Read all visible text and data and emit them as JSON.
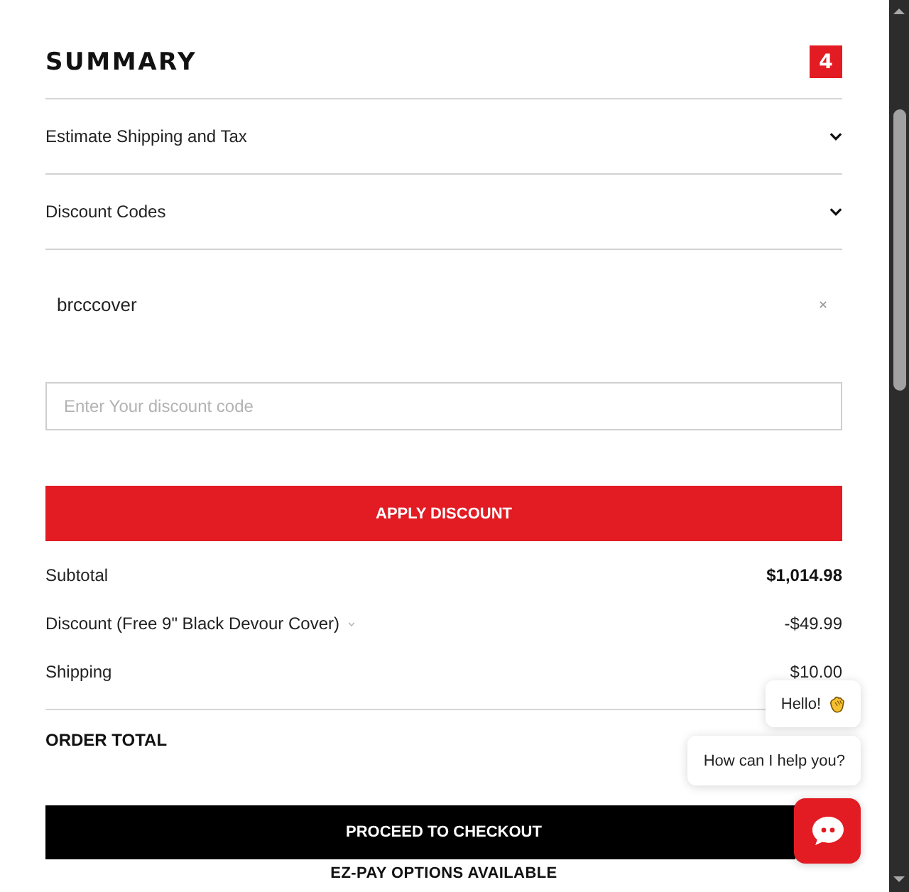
{
  "summary": {
    "title": "SUMMARY",
    "item_count": "4"
  },
  "sections": [
    {
      "label": "Estimate Shipping and Tax"
    },
    {
      "label": "Discount Codes"
    }
  ],
  "discount": {
    "applied_codes": [
      {
        "code": "brcccover"
      }
    ],
    "code_field": {
      "placeholder": "Enter Your discount code"
    },
    "apply_button": "APPLY DISCOUNT"
  },
  "totals": [
    {
      "kind": "subtotal",
      "label": "Subtotal",
      "value": "$1,014.98"
    },
    {
      "kind": "discount",
      "label": "Discount (Free 9\" Black Devour Cover)",
      "value": "-$49.99"
    },
    {
      "kind": "line",
      "label": "Shipping",
      "value": "$10.00"
    },
    {
      "kind": "total",
      "label": "ORDER TOTAL"
    }
  ],
  "checkout": {
    "button": "PROCEED TO CHECKOUT",
    "note": "EZ-PAY OPTIONS AVAILABLE"
  },
  "chat": {
    "messages": [
      {
        "kind": "greeting",
        "text": "Hello!"
      },
      {
        "kind": "text",
        "text": "How can I help you?"
      }
    ]
  }
}
